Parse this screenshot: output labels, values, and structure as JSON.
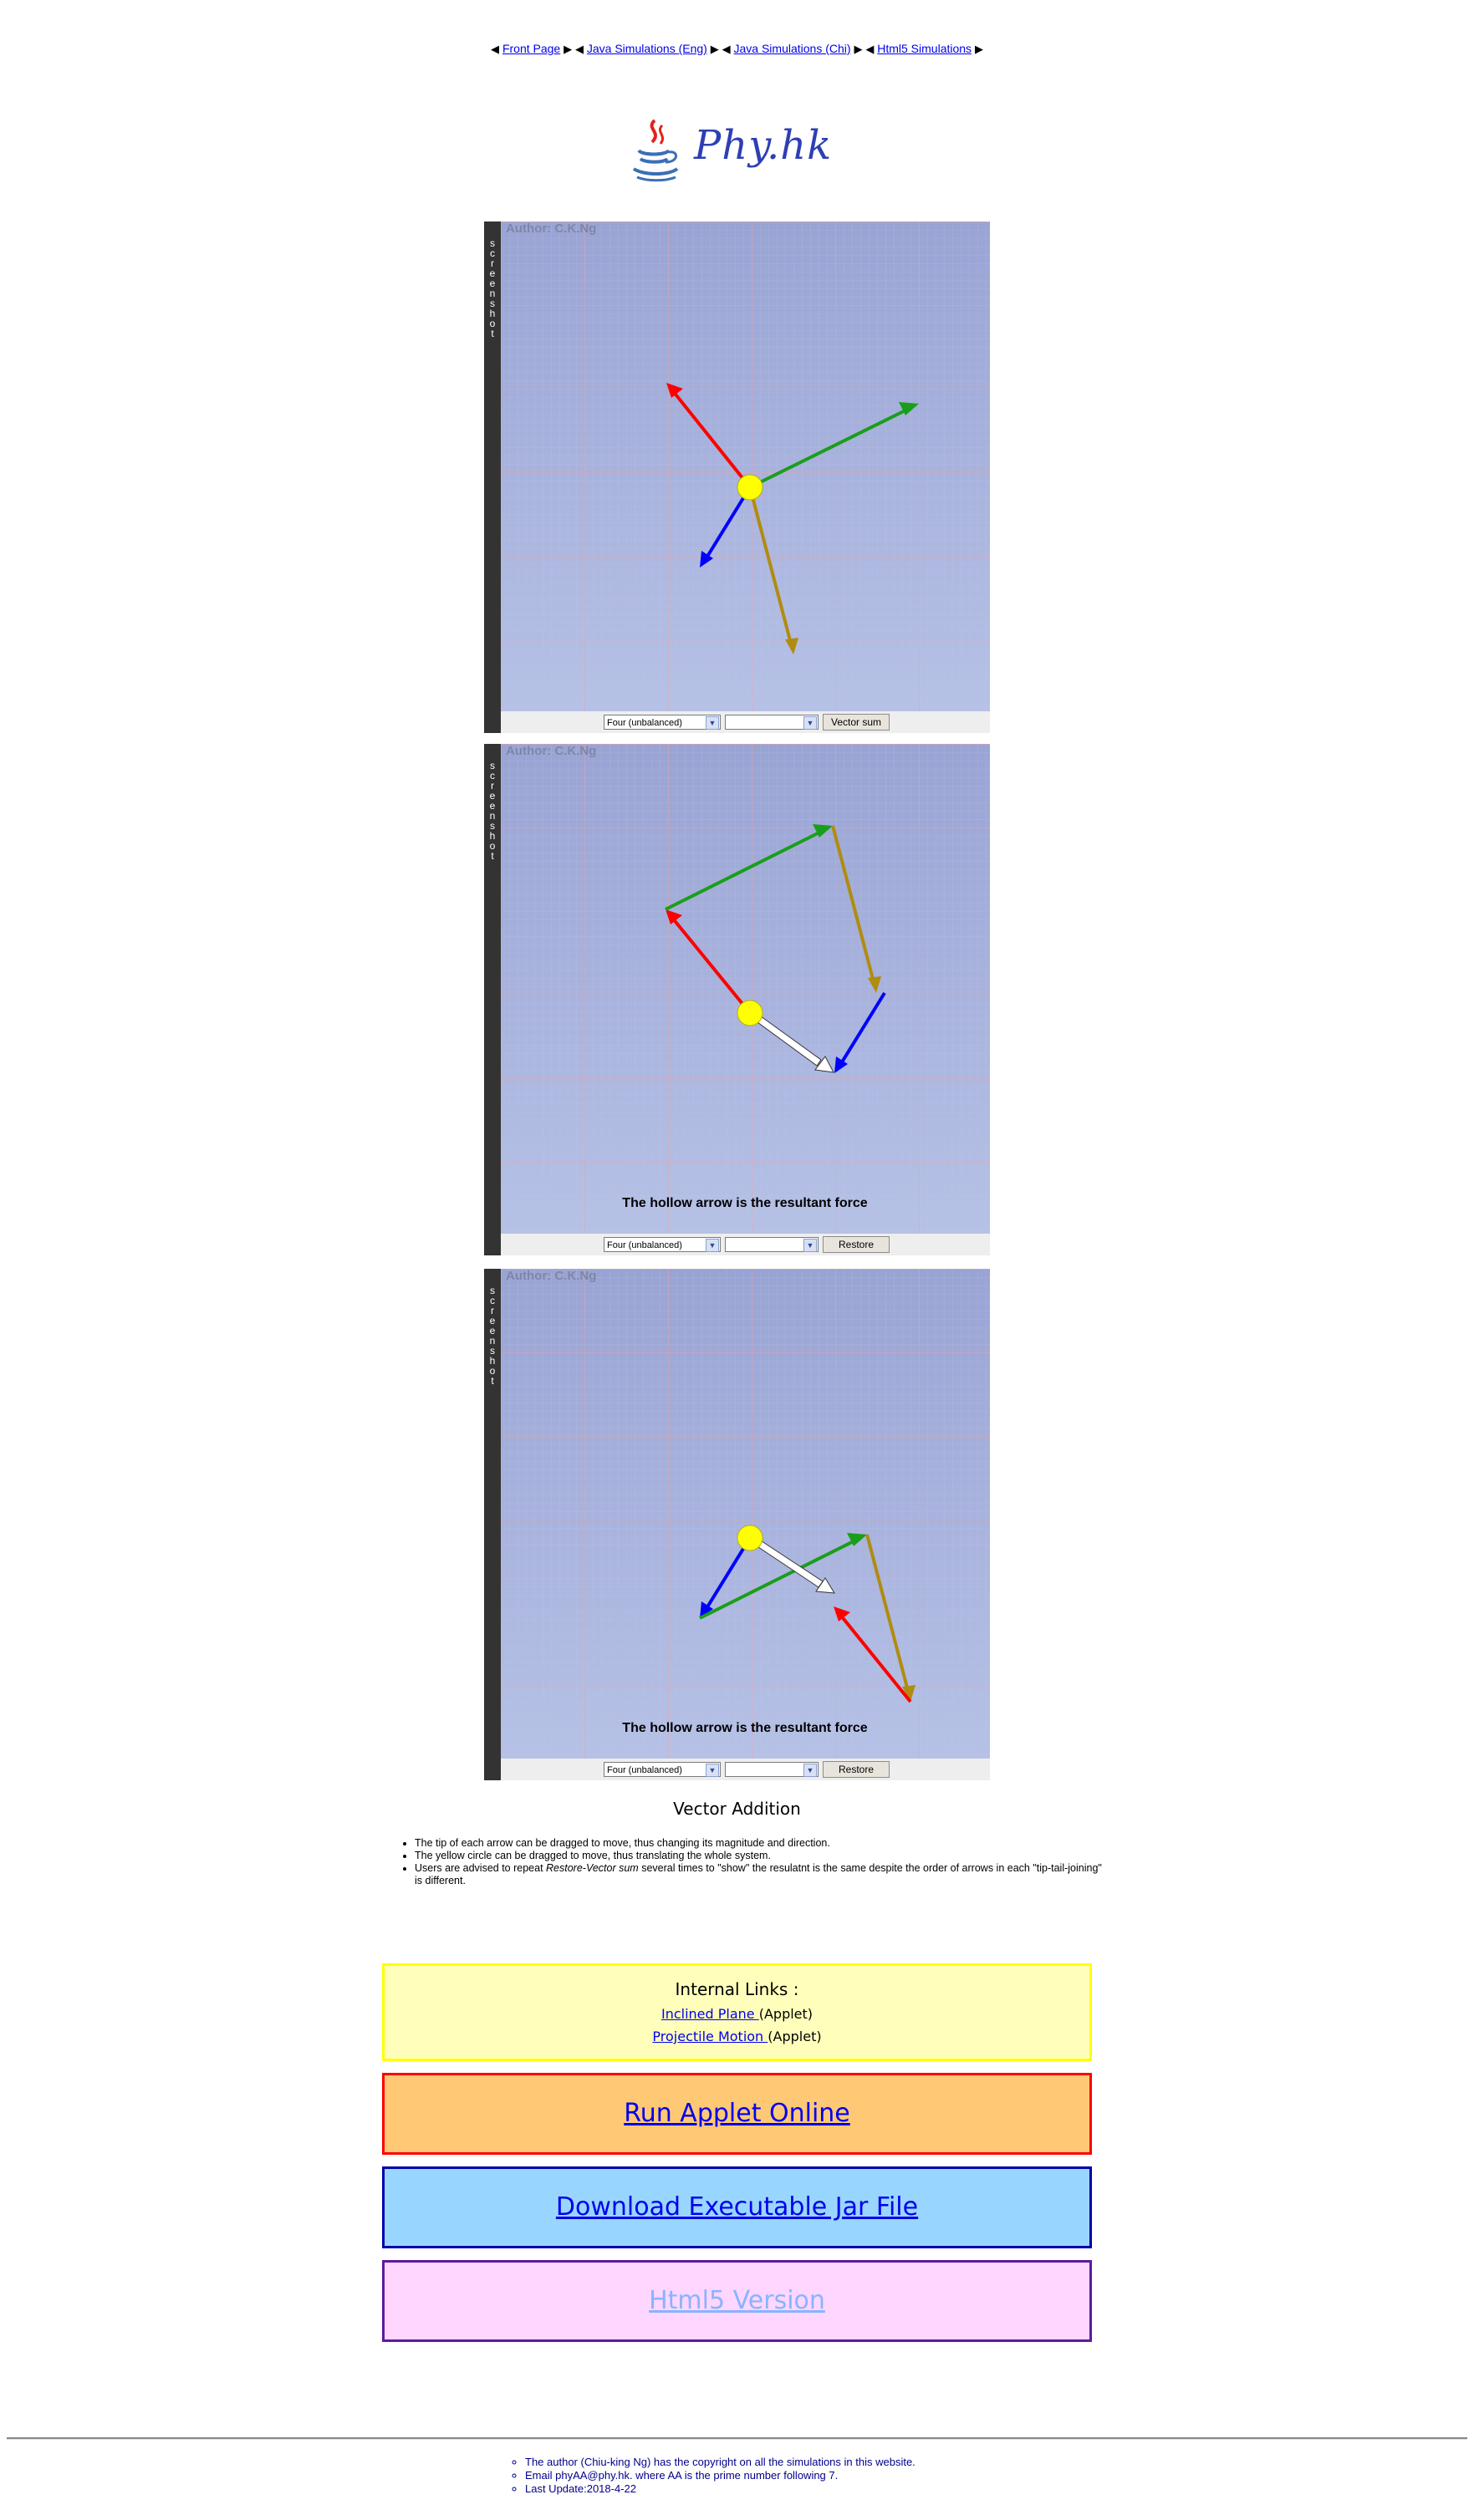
{
  "nav": {
    "items": [
      "Front Page",
      "Java Simulations (Eng)",
      "Java Simulations (Chi)",
      "Html5 Simulations"
    ]
  },
  "logo": {
    "text": "Phy.hk"
  },
  "panels": [
    {
      "author": "Author: C.K.Ng",
      "sidebar_text": "screenshot",
      "select1": "Four (unbalanced)",
      "select2": "",
      "button": "Vector sum",
      "caption": ""
    },
    {
      "author": "Author: C.K.Ng",
      "sidebar_text": "screenshot",
      "select1": "Four (unbalanced)",
      "select2": "",
      "button": "Restore",
      "caption": "The hollow arrow is the resultant force"
    },
    {
      "author": "Author: C.K.Ng",
      "sidebar_text": "screenshot",
      "select1": "Four (unbalanced)",
      "select2": "",
      "button": "Restore",
      "caption": "The hollow arrow is the resultant force"
    }
  ],
  "title": "Vector Addition",
  "description": [
    "The tip of each arrow can be dragged to move, thus changing its magnitude and direction.",
    "The yellow circle can be dragged to move, thus translating the whole system.",
    {
      "pre": "Users are advised to repeat ",
      "em": "Restore-Vector sum",
      "post": " several times to \"show\" the resulatnt is the same despite the order of arrows in each \"tip-tail-joining\" is different."
    }
  ],
  "internal_links": {
    "heading": "Internal Links :",
    "items": [
      {
        "link": "Inclined Plane ",
        "suffix": "(Applet)"
      },
      {
        "link": "Projectile Motion ",
        "suffix": "(Applet)"
      }
    ]
  },
  "run_online": "Run Applet Online",
  "download_jar": "Download Executable Jar File",
  "html5_version": "Html5 Version",
  "footer": [
    "The author (Chiu-king Ng) has the copyright on all the simulations in this website.",
    "Email phyAA@phy.hk. where AA is the prime number following 7.",
    "Last Update:2018-4-22"
  ],
  "colors": {
    "red_arrow": "#ff0000",
    "green_arrow": "#1a9e1a",
    "blue_arrow": "#0000ff",
    "gold_arrow": "#b08c10",
    "hollow_arrow": "#ffffff",
    "yellow_circle": "#ffff00",
    "panel_background": "#b2bde4"
  }
}
